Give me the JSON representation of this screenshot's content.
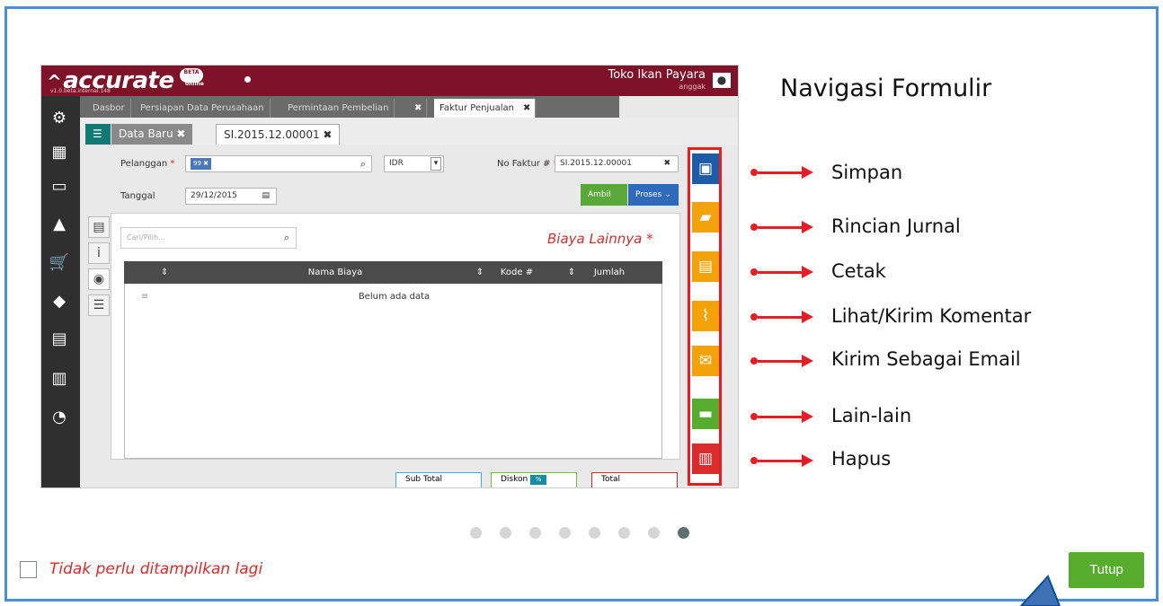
{
  "screenshot": {
    "brand": {
      "name": "accurate",
      "version": "v1.0.beta.internal.148",
      "badge": "BETA",
      "sub": "online"
    },
    "top": {
      "company": "Toko Ikan Payara",
      "user": "anggak"
    },
    "tabs": [
      "Dasbor",
      "Persiapan Data Perusahaan",
      "Permintaan Pembelian",
      "Faktur Penjualan"
    ],
    "subtabs": {
      "data_baru": "Data Baru",
      "invoice": "SI.2015.12.00001"
    },
    "form": {
      "pelanggan_label": "Pelanggan",
      "required_mark": "*",
      "pelanggan_chip": "99",
      "currency": "IDR",
      "no_faktur_label": "No Faktur #",
      "no_faktur_value": "SI.2015.12.00001",
      "tanggal_label": "Tanggal",
      "tanggal_value": "29/12/2015",
      "ambil": "Ambil",
      "proses": "Proses",
      "search_placeholder": "Cari/Pilih...",
      "section_title": "Biaya Lainnya",
      "columns": [
        "Nama Biaya",
        "Kode #",
        "Jumlah"
      ],
      "empty": "Belum ada data",
      "totals": [
        "Sub Total",
        "Diskon",
        "Total"
      ]
    }
  },
  "guide": {
    "title": "Navigasi Formulir",
    "items": [
      {
        "label": "Simpan",
        "color": "#1f5ca8",
        "icon": "save-icon"
      },
      {
        "label": "Rincian Jurnal",
        "color": "#f3a20a",
        "icon": "journal-icon"
      },
      {
        "label": "Cetak",
        "color": "#f3a20a",
        "icon": "print-icon"
      },
      {
        "label": "Lihat/Kirim Komentar",
        "color": "#f3a20a",
        "icon": "paperclip-icon"
      },
      {
        "label": "Kirim Sebagai Email",
        "color": "#f3a20a",
        "icon": "email-icon"
      },
      {
        "label": "Lain-lain",
        "color": "#56ad2d",
        "icon": "briefcase-icon"
      },
      {
        "label": "Hapus",
        "color": "#db2c2c",
        "icon": "trash-icon"
      }
    ]
  },
  "pager": {
    "count": 8,
    "active": 8
  },
  "footer": {
    "dont_show": "Tidak perlu ditampilkan lagi",
    "close": "Tutup"
  }
}
